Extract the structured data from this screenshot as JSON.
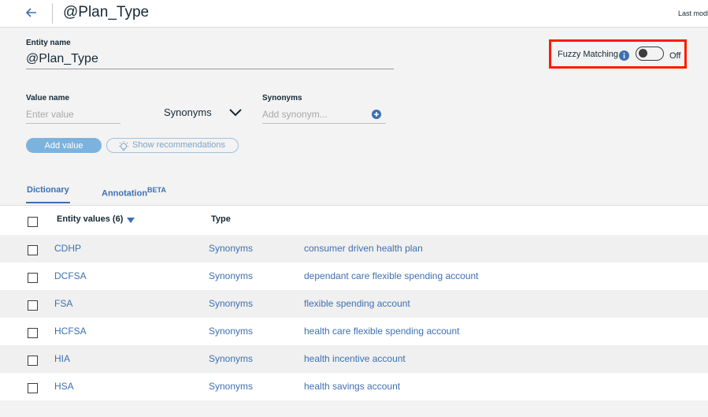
{
  "header": {
    "title": "@Plan_Type",
    "last_modified_text": "Last modified"
  },
  "form": {
    "entity_name_label": "Entity name",
    "entity_name_value": "@Plan_Type",
    "value_name_label": "Value name",
    "value_placeholder": "Enter value",
    "type_select_value": "Synonyms",
    "synonyms_label": "Synonyms",
    "synonym_placeholder": "Add synonym...",
    "add_value_label": "Add value",
    "show_recommendations_label": "Show recommendations"
  },
  "fuzzy": {
    "label": "Fuzzy Matching",
    "state_text": "Off"
  },
  "tabs": {
    "dictionary": "Dictionary",
    "annotation": "Annotation",
    "annotation_badge": "BETA"
  },
  "table": {
    "col_values": "Entity values (6)",
    "col_type": "Type",
    "rows": [
      {
        "value": "CDHP",
        "type": "Synonyms",
        "synonyms": "consumer driven health plan"
      },
      {
        "value": "DCFSA",
        "type": "Synonyms",
        "synonyms": "dependant care flexible spending account"
      },
      {
        "value": "FSA",
        "type": "Synonyms",
        "synonyms": "flexible spending account"
      },
      {
        "value": "HCFSA",
        "type": "Synonyms",
        "synonyms": "health care flexible spending account"
      },
      {
        "value": "HIA",
        "type": "Synonyms",
        "synonyms": "health incentive account"
      },
      {
        "value": "HSA",
        "type": "Synonyms",
        "synonyms": "health savings account"
      }
    ]
  },
  "colors": {
    "link_blue": "#3d70b2",
    "highlight_red": "#ff1a00",
    "primary_button": "#7cb3de"
  }
}
